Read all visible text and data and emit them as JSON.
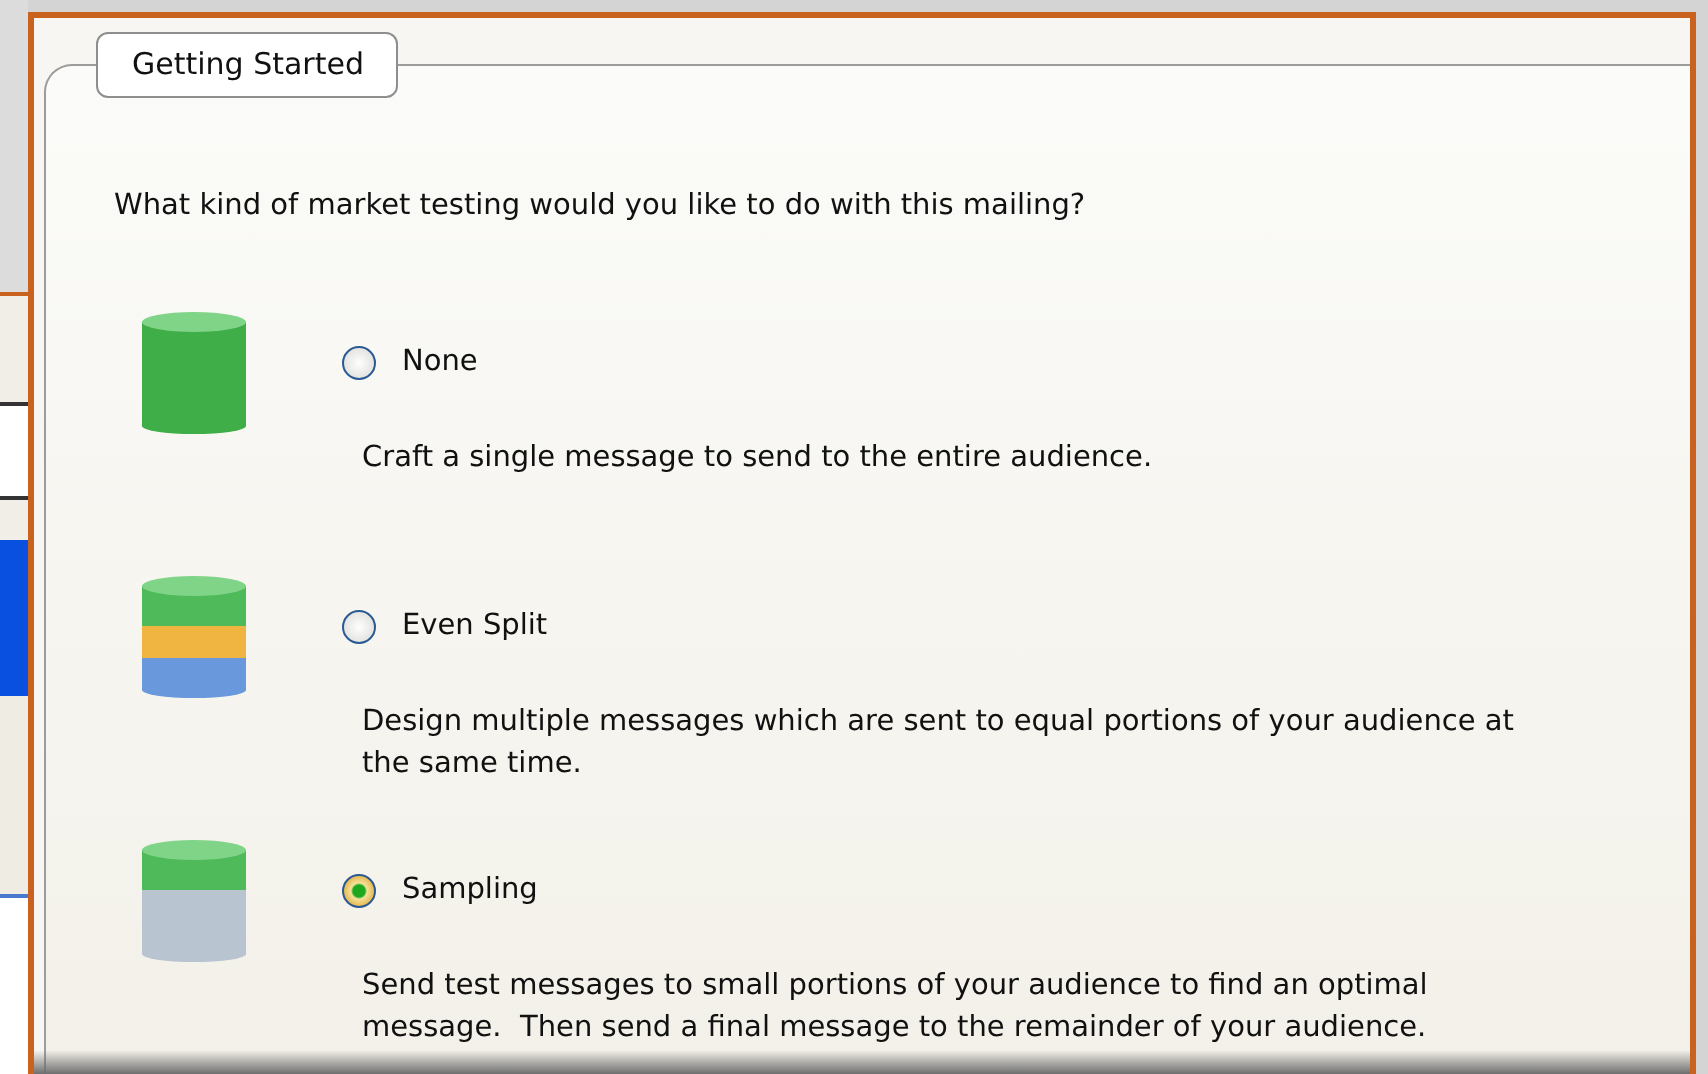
{
  "group": {
    "title": "Getting Started"
  },
  "question": "What kind of market testing would you like to do with this mailing?",
  "options": [
    {
      "kind": "single",
      "label": "None",
      "selected": false,
      "description": [
        "Craft a single message to send to the entire audience."
      ]
    },
    {
      "kind": "split",
      "label": "Even Split",
      "selected": false,
      "description": [
        "Design multiple messages which are sent to equal portions of your audience at",
        "the same time."
      ]
    },
    {
      "kind": "sampling",
      "label": "Sampling",
      "selected": true,
      "description": [
        "Send test messages to small portions of your audience to find an optimal",
        "message.  Then send a final message to the remainder of your audience."
      ]
    }
  ]
}
